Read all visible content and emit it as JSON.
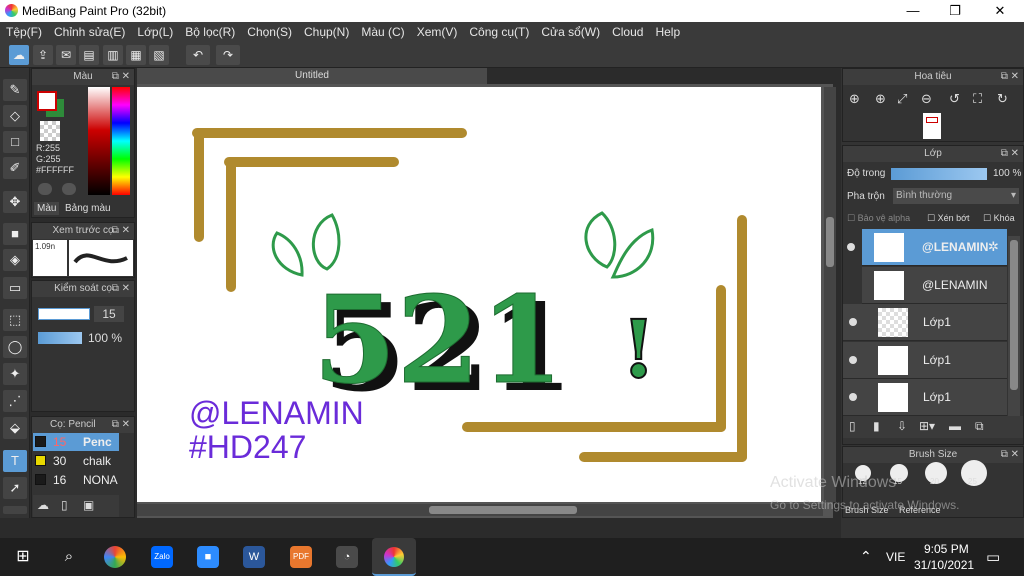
{
  "app": {
    "title": "MediBang Paint Pro (32bit)",
    "window_buttons": [
      "—",
      "❐",
      "✕"
    ]
  },
  "menu": [
    "Tệp(F)",
    "Chỉnh sửa(E)",
    "Lớp(L)",
    "Bộ lọc(R)",
    "Chọn(S)",
    "Chụp(N)",
    "Màu (C)",
    "Xem(V)",
    "Công cụ(T)",
    "Cửa sổ(W)",
    "Cloud",
    "Help"
  ],
  "color_panel": {
    "title": "Màu",
    "r": "R:255",
    "g": "G:255",
    "hex": "#FFFFFF",
    "tabs": [
      "Màu",
      "Bảng màu"
    ]
  },
  "brush_preview": {
    "title": "Xem trước cọ",
    "size": "1.09n"
  },
  "brush_control": {
    "title": "Kiểm soát cọ",
    "size": "15",
    "opacity": "100 %"
  },
  "brush_list": {
    "title": "Cọ: Pencil",
    "items": [
      {
        "num": "15",
        "name": "Penc",
        "color": "#1a1a1a",
        "selected": true
      },
      {
        "num": "30",
        "name": "chalk",
        "color": "#e8d800",
        "selected": false
      },
      {
        "num": "16",
        "name": "NONA",
        "color": "#1a1a1a",
        "selected": false
      }
    ]
  },
  "canvas": {
    "tab": "Untitled",
    "handle": "@LENAMIN",
    "hashtag": "#HD247",
    "number": "521",
    "exclaim": "!"
  },
  "navigator": {
    "title": "Hoa tiêu"
  },
  "layer_panel": {
    "title": "Lớp",
    "opacity_label": "Độ trong",
    "opacity_value": "100 %",
    "blend_label": "Pha trộn",
    "blend_value": "Bình thường",
    "options": [
      "Bảo vệ alpha",
      "Xén bớt",
      "Khóa"
    ],
    "layers": [
      {
        "name": "@LENAMIN",
        "selected": true
      },
      {
        "name": "@LENAMIN",
        "selected": false
      },
      {
        "name": "Lớp1",
        "selected": false
      },
      {
        "name": "Lớp1",
        "selected": false
      },
      {
        "name": "Lớp1",
        "selected": false
      }
    ]
  },
  "brush_size": {
    "title": "Brush Size",
    "sizes": [
      "12",
      "15",
      "20",
      "25"
    ],
    "tabs": [
      "Brush Size",
      "Reference"
    ]
  },
  "watermark": {
    "line1": "Activate Windows",
    "line2": "Go to Settings to activate Windows."
  },
  "taskbar": {
    "lang": "VIE",
    "time": "9:05 PM",
    "date": "31/10/2021"
  },
  "colors": {
    "gold": "#b08a2e",
    "green": "#2e9a4a",
    "purple": "#6a2bd9",
    "accent": "#5b9bd5"
  }
}
